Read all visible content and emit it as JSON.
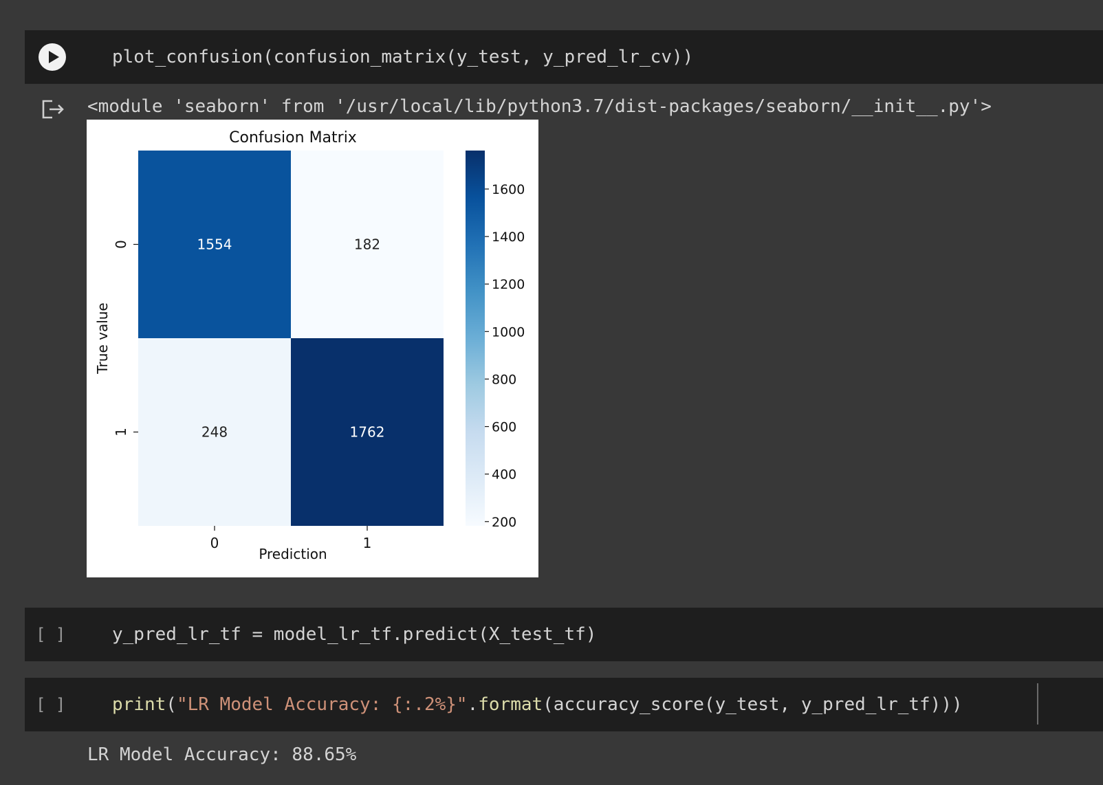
{
  "cells": [
    {
      "code": "plot_confusion(confusion_matrix(y_test, y_pred_lr_cv))",
      "output_text": "<module 'seaborn' from '/usr/local/lib/python3.7/dist-packages/seaborn/__init__.py'>"
    },
    {
      "prompt": "[ ]",
      "code": "y_pred_lr_tf = model_lr_tf.predict(X_test_tf)"
    },
    {
      "prompt": "[ ]",
      "code_parts": {
        "fn": "print",
        "open": "(",
        "string": "\"LR Model Accuracy: {:.2%}\"",
        "dot": ".",
        "method": "format",
        "rest": "(accuracy_score(y_test, y_pred_lr_tf)))"
      },
      "output_text": "LR Model Accuracy: 88.65%"
    }
  ],
  "icons": {
    "run": "play-circle-icon",
    "output": "output-arrow-icon"
  },
  "colors": {
    "background": "#383838",
    "cell_background": "#1e1e1e",
    "string_token": "#ce9178",
    "function_token": "#dcdcaa"
  },
  "chart_data": {
    "type": "heatmap",
    "title": "Confusion Matrix",
    "xlabel": "Prediction",
    "ylabel": "True value",
    "x_categories": [
      "0",
      "1"
    ],
    "y_categories": [
      "0",
      "1"
    ],
    "values": [
      [
        1554,
        182
      ],
      [
        248,
        1762
      ]
    ],
    "colormap": "Blues",
    "colorbar": {
      "range": [
        182,
        1762
      ],
      "ticks": [
        200,
        400,
        600,
        800,
        1000,
        1200,
        1400,
        1600
      ]
    }
  }
}
